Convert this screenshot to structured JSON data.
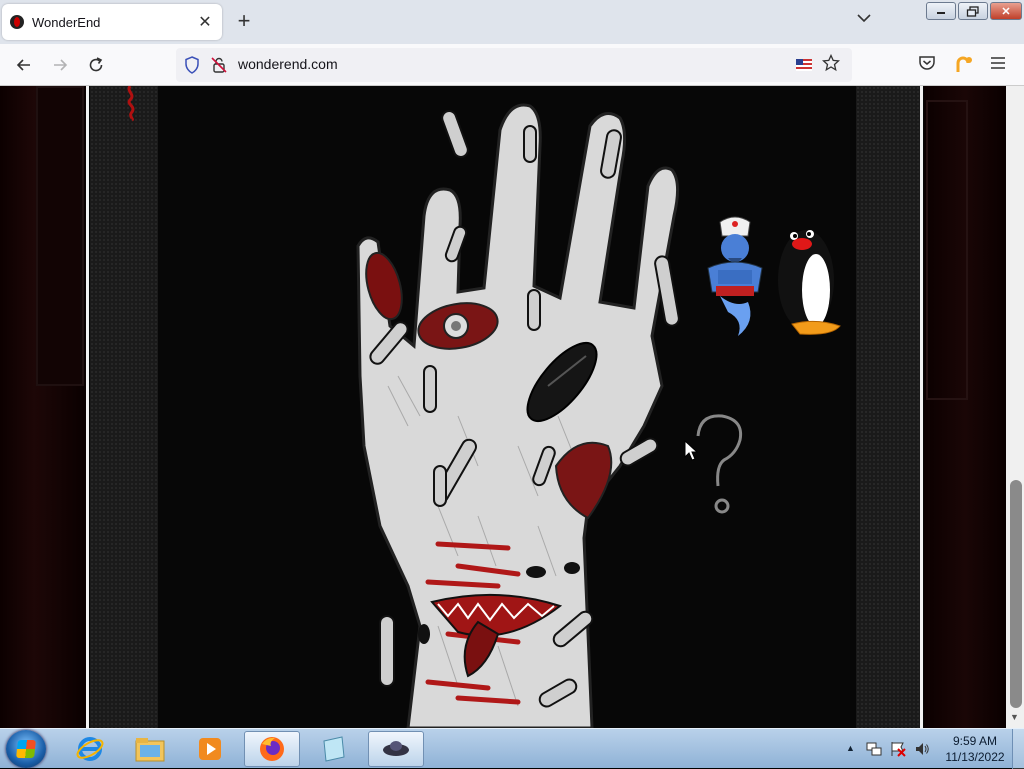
{
  "browser": {
    "tab": {
      "title": "WonderEnd",
      "close_glyph": "✕"
    },
    "new_tab_glyph": "+",
    "tab_list_glyph": "⌵",
    "window_controls": {
      "minimize": "▭",
      "maximize": "❐",
      "close": "✕"
    },
    "url": "wonderend.com",
    "icons": [
      "back-arrow-icon",
      "forward-arrow-icon",
      "reload-icon",
      "shield-icon",
      "lock-crossed-icon",
      "us-flag-icon",
      "bookmark-star-icon",
      "pocket-icon",
      "extension-icon",
      "hamburger-menu-icon"
    ]
  },
  "page": {
    "artwork_description_icons": [
      "zombie-hand-artwork",
      "genie-icon",
      "penguin-icon",
      "question-mark-icon"
    ],
    "question_mark": "?"
  },
  "taskbar": {
    "apps": [
      "internet-explorer",
      "file-explorer",
      "media-player",
      "firefox",
      "notepad",
      "game-controller"
    ],
    "active_app": "firefox",
    "clock_time": "9:59 AM",
    "clock_date": "11/13/2022",
    "tray_up_glyph": "▲"
  }
}
